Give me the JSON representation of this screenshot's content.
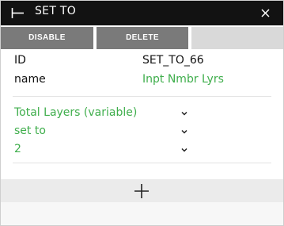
{
  "window": {
    "title": "SET TO",
    "title_icon": "block-start-icon",
    "close_icon": "close-icon"
  },
  "toolbar": {
    "disable_label": "DISABLE",
    "delete_label": "DELETE"
  },
  "properties": [
    {
      "key": "ID",
      "value": "SET_TO_66",
      "value_color": "#111111"
    },
    {
      "key": "name",
      "value": "Inpt Nmbr Lyrs",
      "value_color": "#3fae4c"
    }
  ],
  "params": [
    {
      "value": "Total Layers (variable)"
    },
    {
      "value": "set to"
    },
    {
      "value": "2"
    }
  ],
  "add_button": {
    "icon": "plus-icon"
  },
  "colors": {
    "titlebar": "#121212",
    "button": "#7a7a7a",
    "accent_green": "#3fae4c"
  }
}
